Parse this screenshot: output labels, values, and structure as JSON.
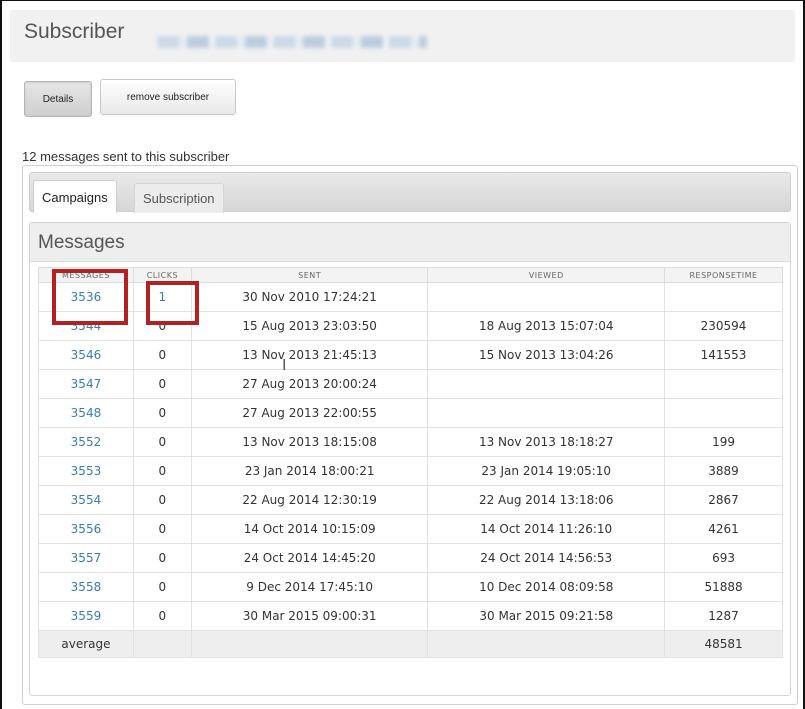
{
  "header": {
    "title": "Subscriber"
  },
  "actions": {
    "details_label": "Details",
    "remove_label": "remove subscriber"
  },
  "summary": "12 messages sent to this subscriber",
  "tabs": [
    {
      "label": "Campaigns",
      "active": true
    },
    {
      "label": "Subscription",
      "active": false
    }
  ],
  "messages_section": {
    "title": "Messages",
    "columns": [
      "MESSAGES",
      "CLICKS",
      "SENT",
      "VIEWED",
      "RESPONSETIME"
    ],
    "rows": [
      {
        "message": "3536",
        "clicks": "1",
        "sent": "30 Nov 2010 17:24:21",
        "viewed": "",
        "responsetime": ""
      },
      {
        "message": "3544",
        "clicks": "0",
        "sent": "15 Aug 2013 23:03:50",
        "viewed": "18 Aug 2013 15:07:04",
        "responsetime": "230594"
      },
      {
        "message": "3546",
        "clicks": "0",
        "sent": "13 Nov 2013 21:45:13",
        "viewed": "15 Nov 2013 13:04:26",
        "responsetime": "141553"
      },
      {
        "message": "3547",
        "clicks": "0",
        "sent": "27 Aug 2013 20:00:24",
        "viewed": "",
        "responsetime": ""
      },
      {
        "message": "3548",
        "clicks": "0",
        "sent": "27 Aug 2013 22:00:55",
        "viewed": "",
        "responsetime": ""
      },
      {
        "message": "3552",
        "clicks": "0",
        "sent": "13 Nov 2013 18:15:08",
        "viewed": "13 Nov 2013 18:18:27",
        "responsetime": "199"
      },
      {
        "message": "3553",
        "clicks": "0",
        "sent": "23 Jan 2014 18:00:21",
        "viewed": "23 Jan 2014 19:05:10",
        "responsetime": "3889"
      },
      {
        "message": "3554",
        "clicks": "0",
        "sent": "22 Aug 2014 12:30:19",
        "viewed": "22 Aug 2014 13:18:06",
        "responsetime": "2867"
      },
      {
        "message": "3556",
        "clicks": "0",
        "sent": "14 Oct 2014 10:15:09",
        "viewed": "14 Oct 2014 11:26:10",
        "responsetime": "4261"
      },
      {
        "message": "3557",
        "clicks": "0",
        "sent": "24 Oct 2014 14:45:20",
        "viewed": "24 Oct 2014 14:56:53",
        "responsetime": "693"
      },
      {
        "message": "3558",
        "clicks": "0",
        "sent": "9 Dec 2014 17:45:10",
        "viewed": "10 Dec 2014 08:09:58",
        "responsetime": "51888"
      },
      {
        "message": "3559",
        "clicks": "0",
        "sent": "30 Mar 2015 09:00:31",
        "viewed": "30 Mar 2015 09:21:58",
        "responsetime": "1287"
      }
    ],
    "average": {
      "label": "average",
      "responsetime": "48581"
    }
  },
  "colors": {
    "link": "#3a7bbf",
    "highlight": "#b22222"
  }
}
